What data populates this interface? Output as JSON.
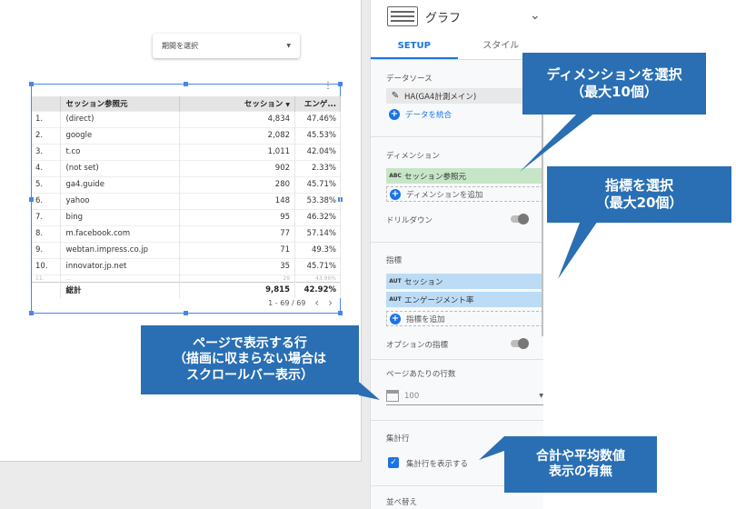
{
  "canvas": {
    "date_picker_label": "期間を選択",
    "table": {
      "columns": [
        "",
        "セッション参照元",
        "セッション",
        "エンゲ..."
      ],
      "rows": [
        {
          "idx": "1.",
          "source": "(direct)",
          "sessions": "4,834",
          "rate": "47.46%"
        },
        {
          "idx": "2.",
          "source": "google",
          "sessions": "2,082",
          "rate": "45.53%"
        },
        {
          "idx": "3.",
          "source": "t.co",
          "sessions": "1,011",
          "rate": "42.04%"
        },
        {
          "idx": "4.",
          "source": "(not set)",
          "sessions": "902",
          "rate": "2.33%"
        },
        {
          "idx": "5.",
          "source": "ga4.guide",
          "sessions": "280",
          "rate": "45.71%"
        },
        {
          "idx": "6.",
          "source": "yahoo",
          "sessions": "148",
          "rate": "53.38%"
        },
        {
          "idx": "7.",
          "source": "bing",
          "sessions": "95",
          "rate": "46.32%"
        },
        {
          "idx": "8.",
          "source": "m.facebook.com",
          "sessions": "77",
          "rate": "57.14%"
        },
        {
          "idx": "9.",
          "source": "webtan.impress.co.jp",
          "sessions": "71",
          "rate": "49.3%"
        },
        {
          "idx": "10.",
          "source": "innovator.jp.net",
          "sessions": "35",
          "rate": "45.71%"
        },
        {
          "idx": "11.",
          "source": "...",
          "sessions": "29",
          "rate": "43.96%"
        }
      ],
      "total": {
        "label": "総計",
        "sessions": "9,815",
        "rate": "42.92%"
      },
      "pager": "1 - 69 / 69"
    }
  },
  "panel": {
    "title": "グラフ",
    "tabs": [
      "SETUP",
      "スタイル"
    ],
    "data_source": {
      "label": "データソース",
      "name": "HA(GA4計測メイン)",
      "blend_label": "データを統合"
    },
    "dimension": {
      "label": "ディメンション",
      "tag": "ABC",
      "value": "セッション参照元",
      "add_label": "ディメンションを追加"
    },
    "drilldown_label": "ドリルダウン",
    "metric": {
      "label": "指標",
      "items": [
        {
          "tag": "AUT",
          "value": "セッション"
        },
        {
          "tag": "AUT",
          "value": "エンゲージメント率"
        }
      ],
      "add_label": "指標を追加"
    },
    "optional_metric_label": "オプションの指標",
    "rows_per_page": {
      "label": "ページあたりの行数",
      "value": "100"
    },
    "summary": {
      "label": "集計行",
      "checkbox_label": "集計行を表示する"
    },
    "sort_label": "並べ替え"
  },
  "callouts": {
    "dimension": [
      "ディメンションを選択",
      "（最大10個）"
    ],
    "metric": [
      "指標を選択",
      "（最大20個）"
    ],
    "rows": [
      "ページで表示する行",
      "（描画に収まらない場合は",
      "スクロールバー表示）"
    ],
    "summary": [
      "合計や平均数値",
      "表示の有無"
    ]
  },
  "colors": {
    "accent": "#1a73e8",
    "callout": "#2a6fb3",
    "dimension_chip": "#c6e6c7",
    "metric_chip": "#bcdcf6"
  }
}
